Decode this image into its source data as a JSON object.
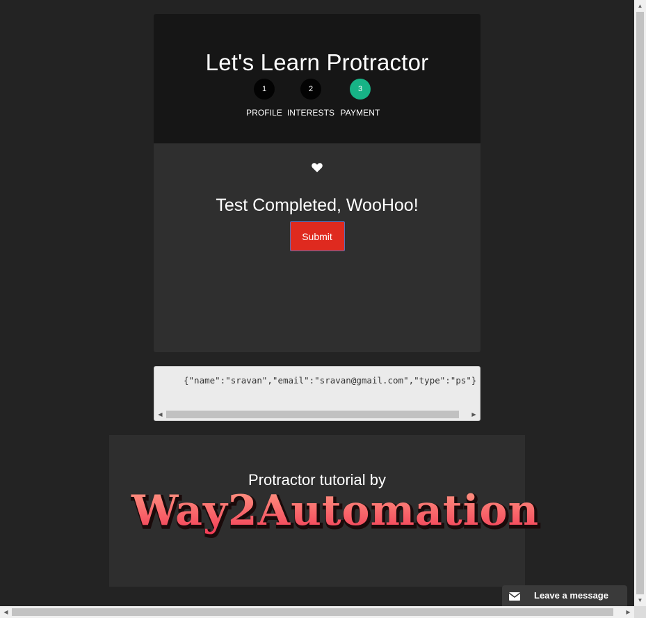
{
  "card": {
    "title": "Let's Learn Protractor",
    "steps": [
      {
        "number": "1",
        "label": "PROFILE",
        "active": false
      },
      {
        "number": "2",
        "label": "INTERESTS",
        "active": false
      },
      {
        "number": "3",
        "label": "PAYMENT",
        "active": true
      }
    ],
    "heart_icon": "heart-icon",
    "completion_message": "Test Completed, WooHoo!",
    "submit_label": "Submit"
  },
  "json_output": "{\"name\":\"sravan\",\"email\":\"sravan@gmail.com\",\"type\":\"ps\"}",
  "footer": {
    "text": "Protractor tutorial by",
    "logo_text": "Way2Automation"
  },
  "chat": {
    "label": "Leave a message",
    "icon": "envelope-icon"
  },
  "colors": {
    "page_bg": "#232323",
    "card_head_bg": "#161616",
    "card_body_bg": "#2f2f2f",
    "active_step": "#17b386",
    "submit_bg": "#df2a1f",
    "logo_fill": "#ff6f6a"
  }
}
